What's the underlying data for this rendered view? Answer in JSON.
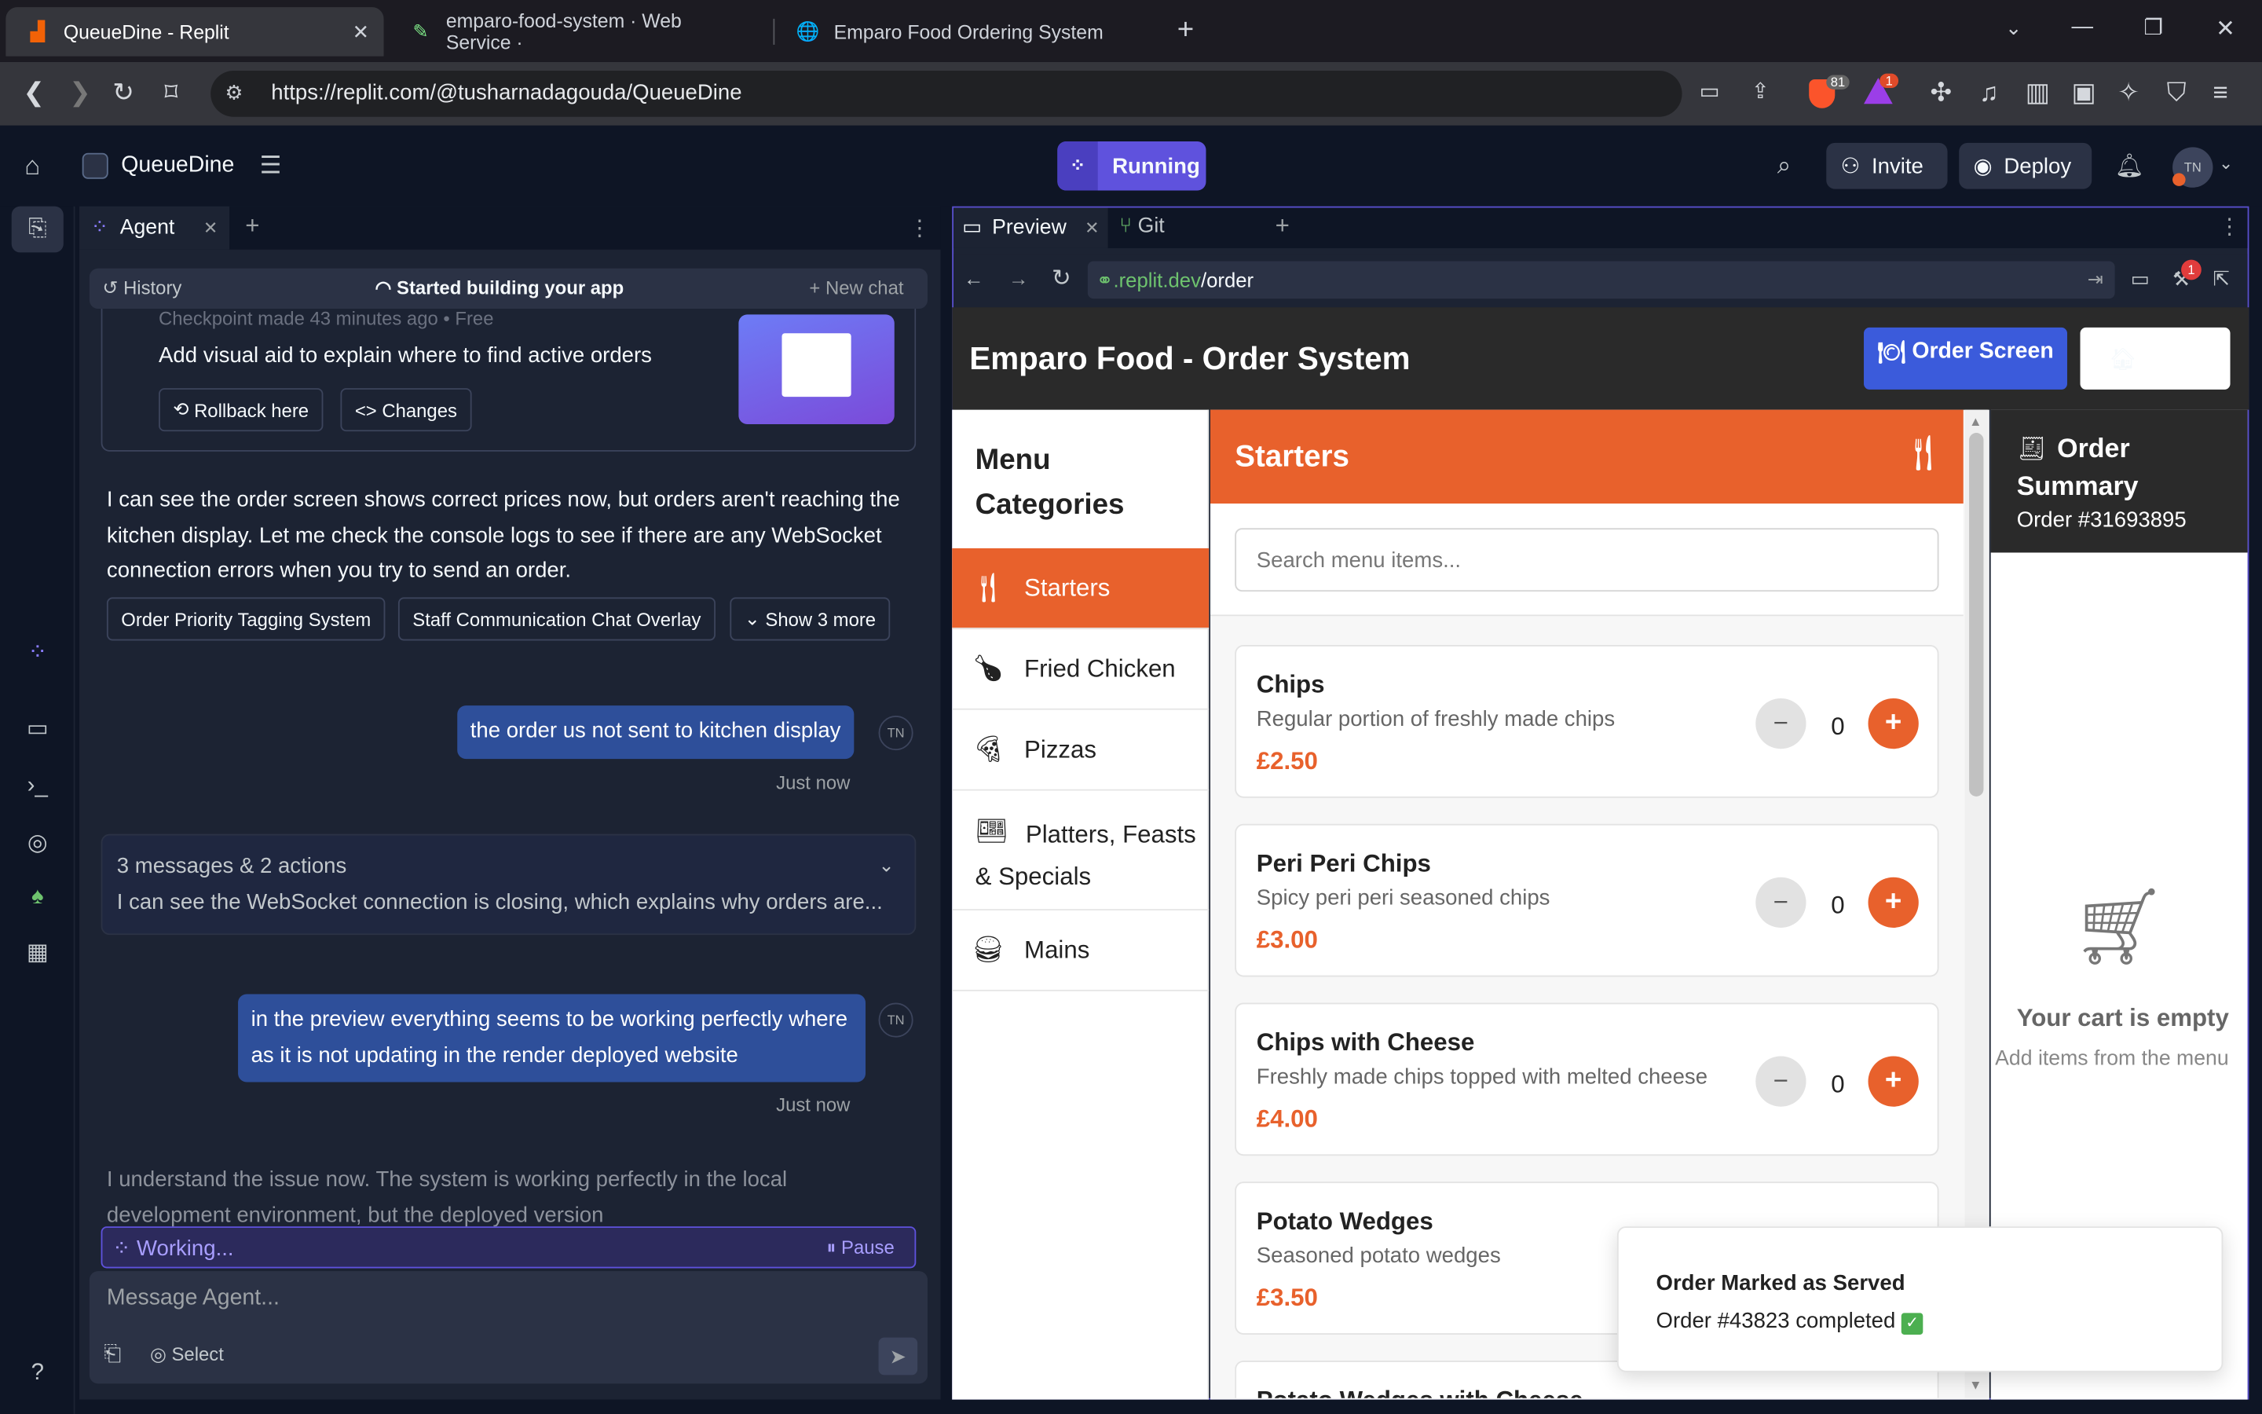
{
  "browser": {
    "tabs": [
      {
        "label": "QueueDine - Replit"
      },
      {
        "label": "emparo-food-system · Web Service ·"
      },
      {
        "label": "Emparo Food Ordering System"
      }
    ],
    "url": "https://replit.com/@tusharnadagouda/QueueDine",
    "brave_count": "81",
    "alert_count": "1"
  },
  "header": {
    "project": "QueueDine",
    "run_label": "Running",
    "invite": "Invite",
    "deploy": "Deploy",
    "avatar": "TN"
  },
  "agent": {
    "tab_label": "Agent",
    "history": "History",
    "started": "Started building your app",
    "new_chat": "+ New chat",
    "checkpoint": "Checkpoint made 43 minutes ago  •  Free",
    "checkpoint_title": "Add visual aid to explain where to find active orders",
    "rollback": "Rollback here",
    "changes": "Changes",
    "msg1": "I can see the order screen shows correct prices now, but orders aren't reaching the kitchen display. Let me check the console logs to see if there are any WebSocket connection errors when you try to send an order.",
    "suggestions": [
      "Order Priority Tagging System",
      "Staff Communication Chat Overlay",
      "Show 3 more"
    ],
    "user1": "the order us not sent to kitchen display",
    "user1_time": "Just now",
    "collapsed_title": "3 messages & 2 actions",
    "collapsed_text": "I can see the WebSocket connection is closing, which explains why orders are...",
    "user2": "in the preview everything seems to be working perfectly where as it is not updating in the render deployed website",
    "user2_time": "Just now",
    "msg2": "I understand the issue now. The system is working perfectly in the local development environment, but the deployed version",
    "working": "Working...",
    "pause": "Pause",
    "input_placeholder": "Message Agent...",
    "select": "Select"
  },
  "preview": {
    "tab_preview": "Preview",
    "tab_git": "Git",
    "url_host": ".replit.dev",
    "url_path": "/order",
    "badge": "1"
  },
  "app": {
    "title": "Emparo Food - Order System",
    "order_screen_btn": "Order Screen",
    "categories_title": "Menu Categories",
    "categories": [
      {
        "label": "Starters",
        "icon": "utensils-icon"
      },
      {
        "label": "Fried Chicken",
        "icon": "drumstick-icon"
      },
      {
        "label": "Pizzas",
        "icon": "pizza-icon"
      },
      {
        "label": "Platters, Feasts & Specials",
        "icon": "platter-icon"
      },
      {
        "label": "Mains",
        "icon": "burger-icon"
      }
    ],
    "section": "Starters",
    "search_placeholder": "Search menu items...",
    "items": [
      {
        "name": "Chips",
        "desc": "Regular portion of freshly made chips",
        "price": "£2.50",
        "qty": "0"
      },
      {
        "name": "Peri Peri Chips",
        "desc": "Spicy peri peri seasoned chips",
        "price": "£3.00",
        "qty": "0"
      },
      {
        "name": "Chips with Cheese",
        "desc": "Freshly made chips topped with melted cheese",
        "price": "£4.00",
        "qty": "0"
      },
      {
        "name": "Potato Wedges",
        "desc": "Seasoned potato wedges",
        "price": "£3.50"
      },
      {
        "name": "Potato Wedges with Cheese"
      }
    ],
    "summary_title": "Order Summary",
    "order_no": "Order #31693895",
    "empty": "Your cart is empty",
    "empty_sub": "Add items from the menu",
    "toast_title": "Order Marked as Served",
    "toast_text": "Order #43823 completed"
  },
  "colors": {
    "accent": "#e8612c",
    "replit_purple": "#5f52dd",
    "user_bubble": "#2e4f9a"
  }
}
